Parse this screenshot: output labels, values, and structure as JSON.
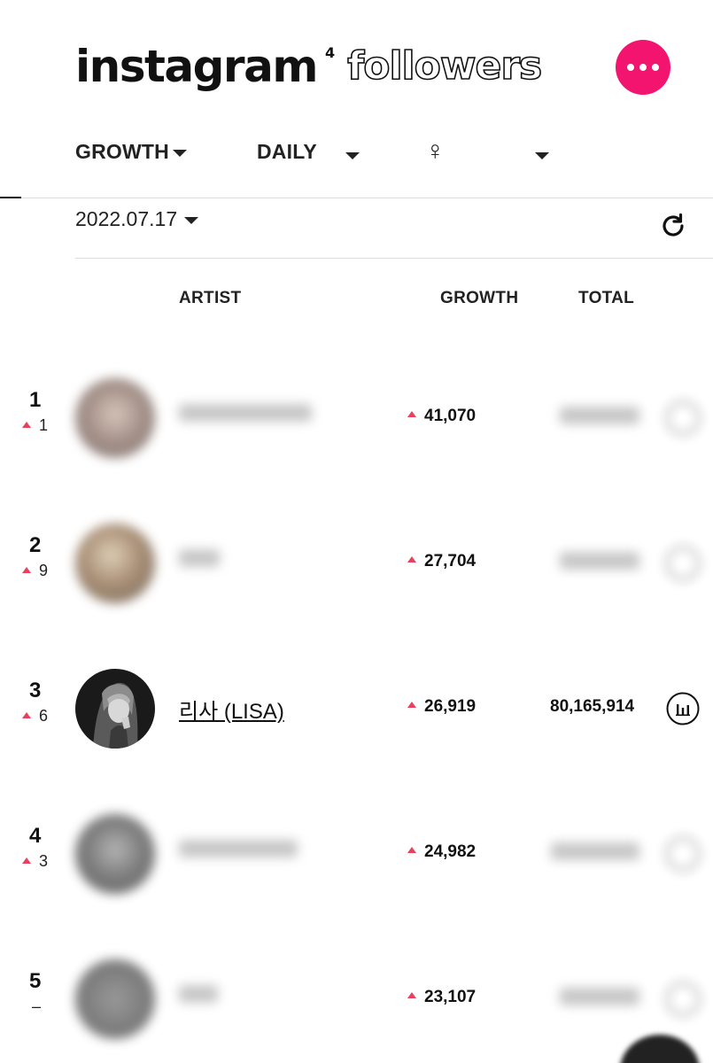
{
  "header": {
    "logo_main": "instagram",
    "logo_sup": "4",
    "logo_outline": "followers",
    "more_color": "#f2146e",
    "more_icon": "more-dots-icon"
  },
  "filters": {
    "type": "GROWTH",
    "period": "DAILY",
    "gender_symbol": "♀"
  },
  "date": "2022.07.17",
  "refresh_icon": "refresh-icon",
  "table": {
    "columns": [
      "ARTIST",
      "GROWTH",
      "TOTAL"
    ],
    "rows": [
      {
        "rank": "1",
        "change": "1",
        "change_dir": "up",
        "name": "",
        "growth": "41,070",
        "total": "",
        "blurred": true
      },
      {
        "rank": "2",
        "change": "9",
        "change_dir": "up",
        "name": "",
        "growth": "27,704",
        "total": "",
        "blurred": true
      },
      {
        "rank": "3",
        "change": "6",
        "change_dir": "up",
        "name": "리사 (LISA)",
        "growth": "26,919",
        "total": "80,165,914",
        "blurred": false
      },
      {
        "rank": "4",
        "change": "3",
        "change_dir": "up",
        "name": "",
        "growth": "24,982",
        "total": "",
        "blurred": true
      },
      {
        "rank": "5",
        "change": "–",
        "change_dir": "same",
        "name": "",
        "growth": "23,107",
        "total": "",
        "blurred": true
      }
    ]
  },
  "colors": {
    "accent": "#f2146e",
    "up": "#e8415f"
  }
}
